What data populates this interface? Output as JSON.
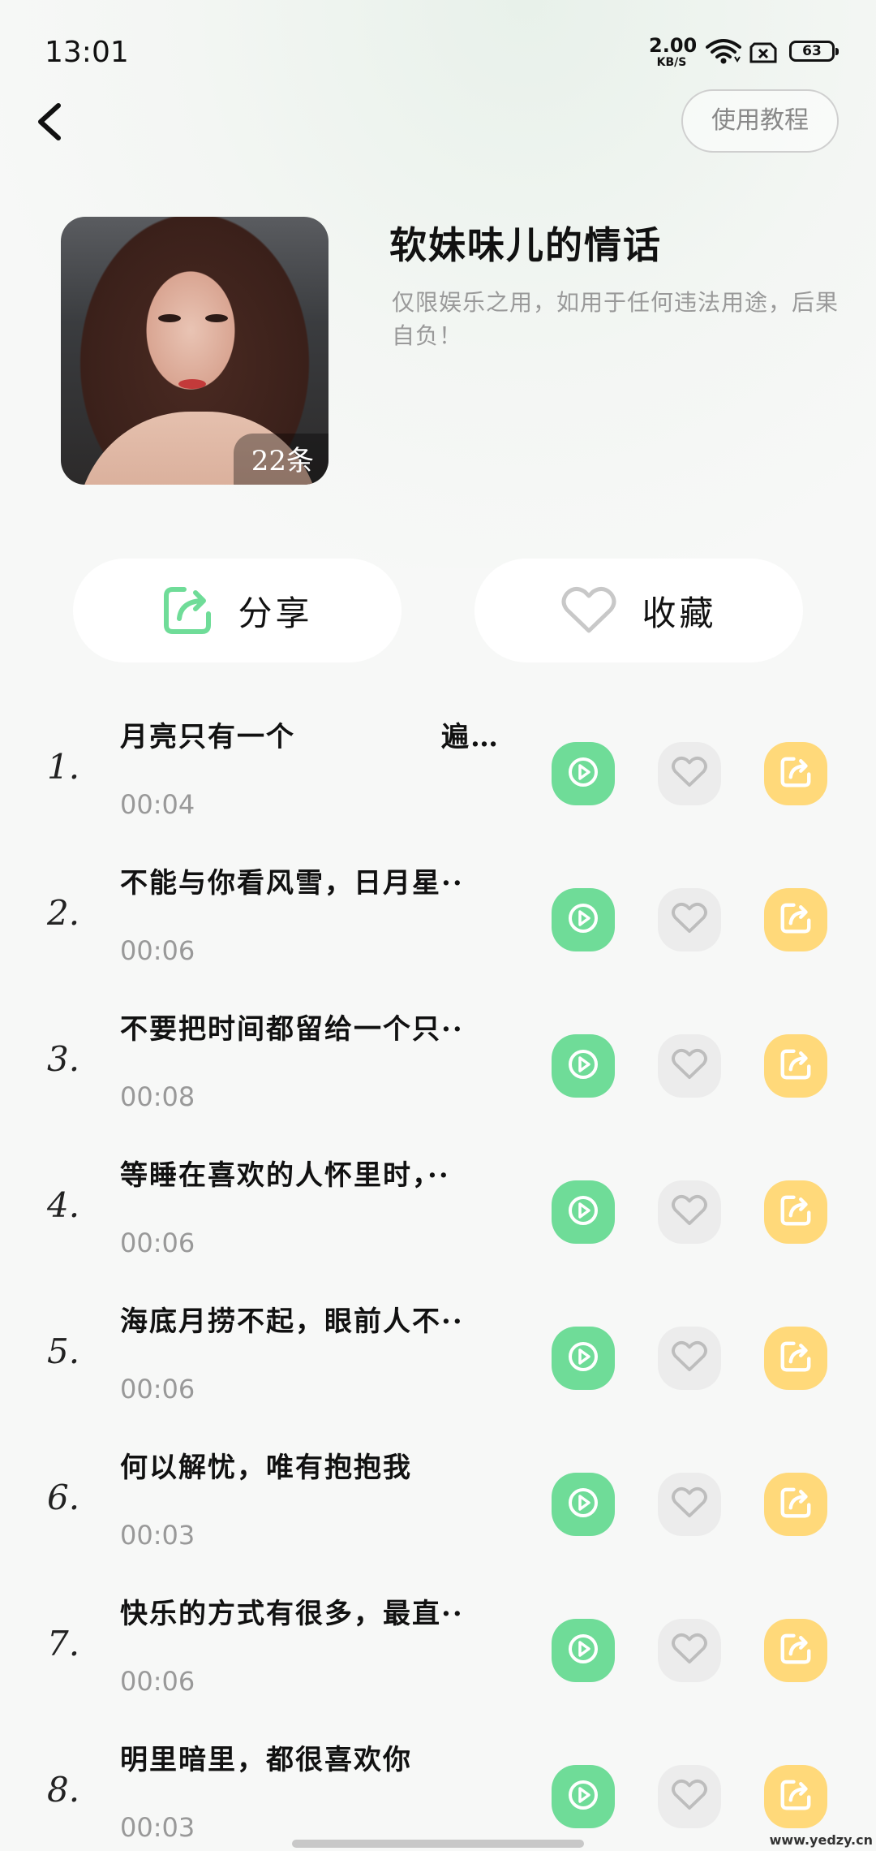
{
  "status_bar": {
    "time": "13:01",
    "net_speed_value": "2.00",
    "net_speed_unit": "KB/S",
    "battery": "63"
  },
  "header": {
    "tutorial_label": "使用教程"
  },
  "album": {
    "title": "软妹味儿的情话",
    "disclaimer": "仅限娱乐之用，如用于任何违法用途，后果自负！",
    "count_label": "22条"
  },
  "actions": {
    "share_label": "分享",
    "favorite_label": "收藏"
  },
  "colors": {
    "play": "#6fdc98",
    "like": "#ececec",
    "share": "#ffd97a"
  },
  "tracks": [
    {
      "num": "1.",
      "title": "月亮只有一个　　　　　遍地都",
      "duration": "00:04"
    },
    {
      "num": "2.",
      "title": "不能与你看风雪，日月星··",
      "duration": "00:06"
    },
    {
      "num": "3.",
      "title": "不要把时间都留给一个只··",
      "duration": "00:08"
    },
    {
      "num": "4.",
      "title": "等睡在喜欢的人怀里时，··",
      "duration": "00:06"
    },
    {
      "num": "5.",
      "title": "海底月捞不起，眼前人不··",
      "duration": "00:06"
    },
    {
      "num": "6.",
      "title": "何以解忧，唯有抱抱我",
      "duration": "00:03"
    },
    {
      "num": "7.",
      "title": "快乐的方式有很多，最直··",
      "duration": "00:06"
    },
    {
      "num": "8.",
      "title": "明里暗里，都很喜欢你",
      "duration": "00:03"
    }
  ],
  "watermark": "www.yedzy.cn"
}
